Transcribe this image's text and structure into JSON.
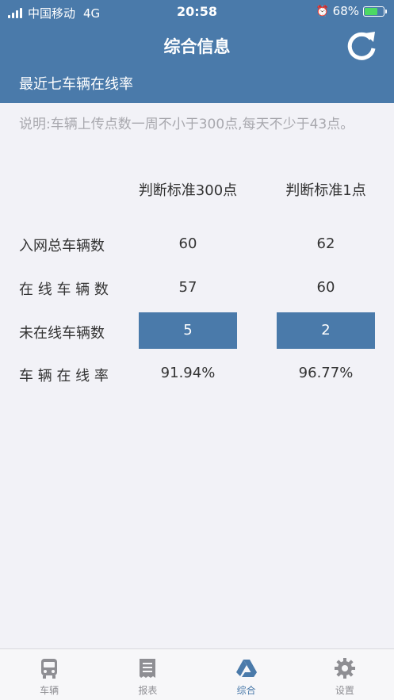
{
  "statusbar": {
    "carrier": "中国移动",
    "network": "4G",
    "time": "20:58",
    "battery": "68%"
  },
  "navbar": {
    "title": "综合信息",
    "refresh_icon": "refresh-icon"
  },
  "section": {
    "title": "最近七车辆在线率"
  },
  "note": "说明:车辆上传点数一周不小于300点,每天不少于43点。",
  "table": {
    "headers": [
      "判断标准300点",
      "判断标准1点"
    ],
    "rows": [
      {
        "label": "入网总车辆数",
        "values": [
          "60",
          "62"
        ]
      },
      {
        "label": "在 线 车 辆 数",
        "values": [
          "57",
          "60"
        ]
      },
      {
        "label": "未在线车辆数",
        "values": [
          "5",
          "2"
        ]
      },
      {
        "label": "车 辆 在 线 率",
        "values": [
          "91.94%",
          "96.77%"
        ]
      }
    ]
  },
  "tabs": [
    {
      "label": "车辆",
      "icon": "bus-icon"
    },
    {
      "label": "报表",
      "icon": "report-icon"
    },
    {
      "label": "综合",
      "icon": "drive-triangle-icon"
    },
    {
      "label": "设置",
      "icon": "gear-icon"
    }
  ],
  "colors": {
    "accent": "#4a7aaa",
    "battery": "#4cd964",
    "note": "#a8a8ae"
  }
}
